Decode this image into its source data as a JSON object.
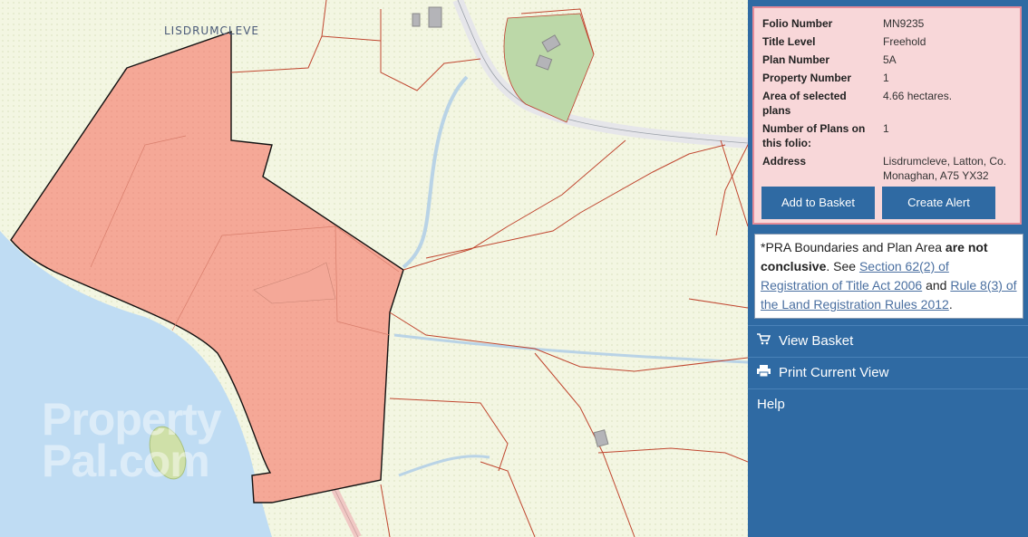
{
  "map": {
    "place_label": "LISDRUMCLEVE",
    "watermark_line1": "Property",
    "watermark_line2": "Pal.com"
  },
  "info": {
    "rows": [
      {
        "key": "Folio Number",
        "value": "MN9235"
      },
      {
        "key": "Title Level",
        "value": "Freehold"
      },
      {
        "key": "Plan Number",
        "value": "5A"
      },
      {
        "key": "Property Number",
        "value": "1"
      },
      {
        "key": "Area of selected plans",
        "value": "4.66 hectares."
      },
      {
        "key": "Number of Plans on this folio:",
        "value": "1"
      },
      {
        "key": "Address",
        "value": "Lisdrumcleve, Latton, Co. Monaghan, A75 YX32"
      }
    ],
    "add_to_basket": "Add to Basket",
    "create_alert": "Create Alert"
  },
  "notice": {
    "prefix": "*PRA Boundaries and Plan Area ",
    "bold": "are not conclusive",
    "mid": ". See ",
    "link1": "Section 62(2) of Registration of Title Act 2006",
    "and": " and ",
    "link2": "Rule 8(3) of the Land Registration Rules 2012",
    "end": "."
  },
  "menu": {
    "view_basket": "View Basket",
    "print_view": "Print Current View",
    "help": "Help"
  }
}
